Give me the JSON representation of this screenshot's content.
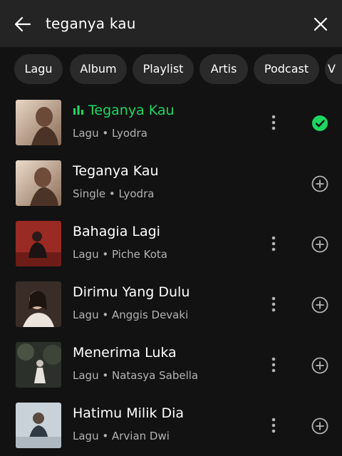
{
  "search": {
    "query": "teganya kau",
    "back_icon": "arrow-left-icon",
    "clear_icon": "close-icon"
  },
  "filters": [
    "Lagu",
    "Album",
    "Playlist",
    "Artis",
    "Podcast",
    "V"
  ],
  "colors": {
    "background": "#121212",
    "header": "#242424",
    "chip": "#2a2a2a",
    "accent": "#1ed760",
    "secondary_text": "#b3b3b3"
  },
  "results": [
    {
      "title": "Teganya Kau",
      "type": "Lagu",
      "artist": "Lyodra",
      "playing": true,
      "status_icon": "check-circle-icon"
    },
    {
      "title": "Teganya Kau",
      "type": "Single",
      "artist": "Lyodra",
      "playing": false,
      "status_icon": "add-circle-icon"
    },
    {
      "title": "Bahagia Lagi",
      "type": "Lagu",
      "artist": "Piche Kota",
      "playing": false,
      "status_icon": "add-circle-icon"
    },
    {
      "title": "Dirimu Yang Dulu",
      "type": "Lagu",
      "artist": "Anggis Devaki",
      "playing": false,
      "status_icon": "add-circle-icon"
    },
    {
      "title": "Menerima Luka",
      "type": "Lagu",
      "artist": "Natasya Sabella",
      "playing": false,
      "status_icon": "add-circle-icon"
    },
    {
      "title": "Hatimu Milik Dia",
      "type": "Lagu",
      "artist": "Arvian Dwi",
      "playing": false,
      "status_icon": "add-circle-icon"
    }
  ],
  "separator": " • "
}
